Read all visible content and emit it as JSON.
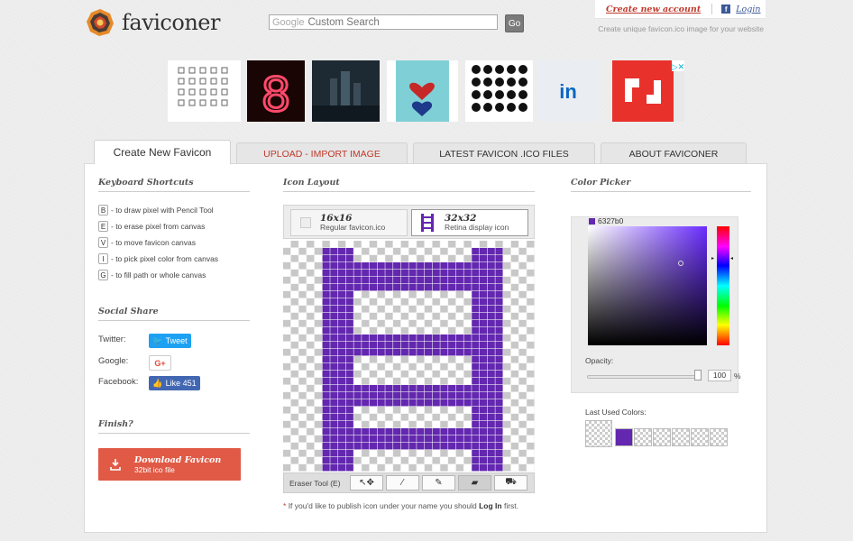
{
  "header": {
    "brand": "faviconer",
    "search_placeholder": "Custom Search",
    "search_brand": "Google",
    "go_label": "Go",
    "create_account": "Create new account",
    "login": "Login",
    "tagline": "Create unique favicon.ico image for your website"
  },
  "ads": {
    "neon_digit": "8",
    "linkedin": "in"
  },
  "tabs": [
    "Create New Favicon",
    "UPLOAD - IMPORT IMAGE",
    "LATEST FAVICON .ICO FILES",
    "ABOUT FAVICONER"
  ],
  "left": {
    "shortcuts_title": "Keyboard Shortcuts",
    "shortcuts": [
      {
        "key": "B",
        "text": "- to draw pixel with Pencil Tool"
      },
      {
        "key": "E",
        "text": "- to erase pixel from canvas"
      },
      {
        "key": "V",
        "text": "- to move favicon canvas"
      },
      {
        "key": "I",
        "text": "- to pick pixel color from canvas"
      },
      {
        "key": "G",
        "text": "- to fill path or whole canvas"
      }
    ],
    "social_title": "Social Share",
    "twitter_label": "Twitter:",
    "tweet": "Tweet",
    "google_label": "Google:",
    "gplus": "G+",
    "facebook_label": "Facebook:",
    "like": "Like 451",
    "finish_title": "Finish?",
    "download_title": "Download Favicon",
    "download_sub": "32bit ico file"
  },
  "middle": {
    "title": "Icon Layout",
    "size_16": "16x16",
    "size_16_sub": "Regular favicon.ico",
    "size_32": "32x32",
    "size_32_sub": "Retina display icon",
    "tool_label": "Eraser Tool (E)",
    "note_prefix": "If you'd like to publish icon under your name you should ",
    "note_login": "Log In",
    "note_suffix": " first."
  },
  "right": {
    "title": "Color Picker",
    "hex": "6327b0",
    "current_color": "#6327b0",
    "opacity_label": "Opacity:",
    "opacity_value": "100",
    "opacity_unit": "%",
    "last_used_label": "Last Used Colors:",
    "last_used": [
      "transparent",
      "#6327b0",
      "transparent",
      "transparent",
      "transparent",
      "transparent",
      "transparent"
    ]
  },
  "colors": {
    "accent": "#c0392b",
    "pixel": "#6327b0",
    "download": "#e05a46"
  }
}
